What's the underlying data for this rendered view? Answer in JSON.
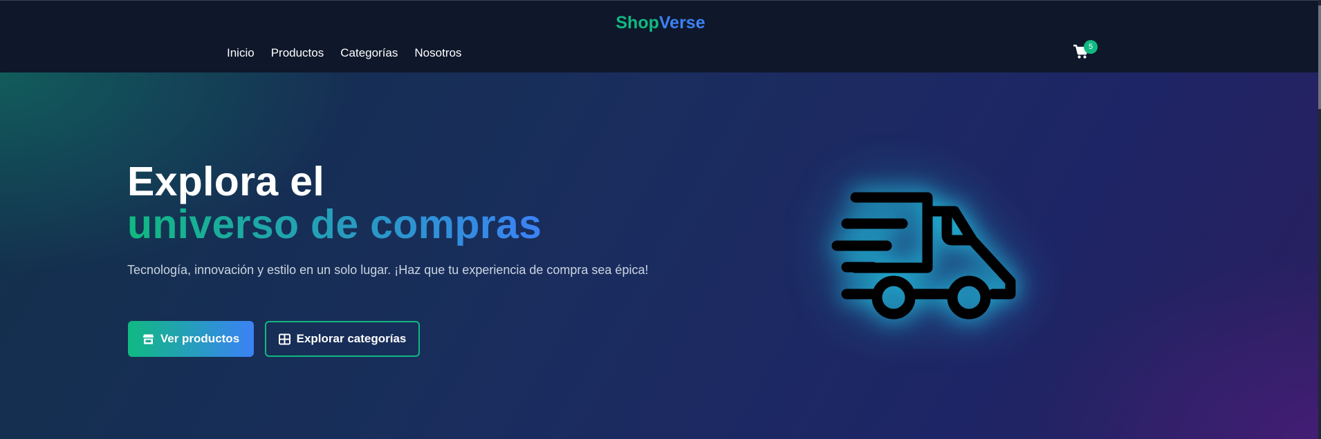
{
  "brand": {
    "part1": "Shop",
    "part2": "Verse"
  },
  "nav": {
    "items": [
      {
        "label": "Inicio"
      },
      {
        "label": "Productos"
      },
      {
        "label": "Categorías"
      },
      {
        "label": "Nosotros"
      }
    ]
  },
  "cart": {
    "icon": "shopping-cart-icon",
    "count": "5"
  },
  "hero": {
    "title_line1": "Explora el",
    "title_line2": "universo de compras",
    "subtitle": "Tecnología, innovación y estilo en un solo lugar. ¡Haz que tu experiencia de compra sea épica!",
    "primary_button": {
      "label": "Ver productos",
      "icon": "store-icon"
    },
    "secondary_button": {
      "label": "Explorar categorías",
      "icon": "grid-icon"
    },
    "illustration_icon": "fast-delivery-truck-icon"
  },
  "colors": {
    "accent_green": "#10b981",
    "accent_blue": "#3b82f6",
    "navbar_bg": "#0f172a",
    "glow": "#22d3ee"
  }
}
